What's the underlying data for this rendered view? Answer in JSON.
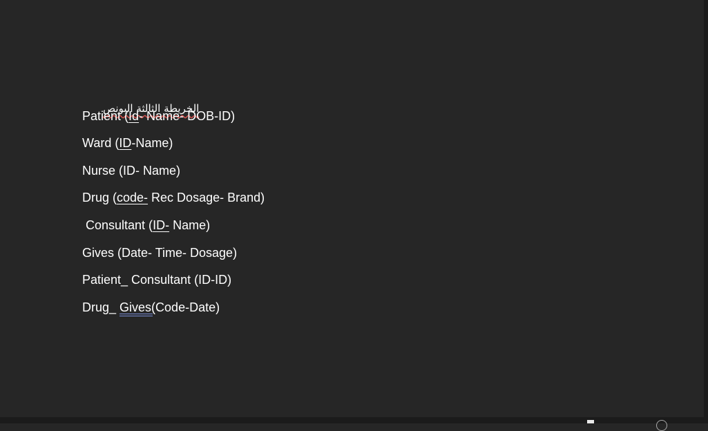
{
  "document": {
    "heading_arabic": "الخريطة الثالثة البونص",
    "lines": [
      {
        "pre": "Patient (",
        "u": "Id",
        "post": "- Name- DOB-ID)"
      },
      {
        "pre": "Ward (",
        "u": "ID",
        "post": "-Name)"
      },
      {
        "pre": "Nurse (ID- Name)",
        "u": "",
        "post": ""
      },
      {
        "pre": "Drug (",
        "u": "code-",
        "post": " Rec Dosage- Brand)"
      },
      {
        "pre": " Consultant (",
        "u": "ID-",
        "post": " Name)"
      },
      {
        "pre": "Gives (Date- Time- Dosage)",
        "u": "",
        "post": ""
      },
      {
        "pre": "Patient_ Consultant (ID-ID)",
        "u": "",
        "post": ""
      },
      {
        "pre": "Drug_ ",
        "u": "Gives(",
        "post": "Code-Date)"
      }
    ]
  },
  "colors": {
    "background": "#262626",
    "text": "#ffffff",
    "spell_error_underline": "#d9534f",
    "grammar_underline": "#7b8fd8"
  }
}
